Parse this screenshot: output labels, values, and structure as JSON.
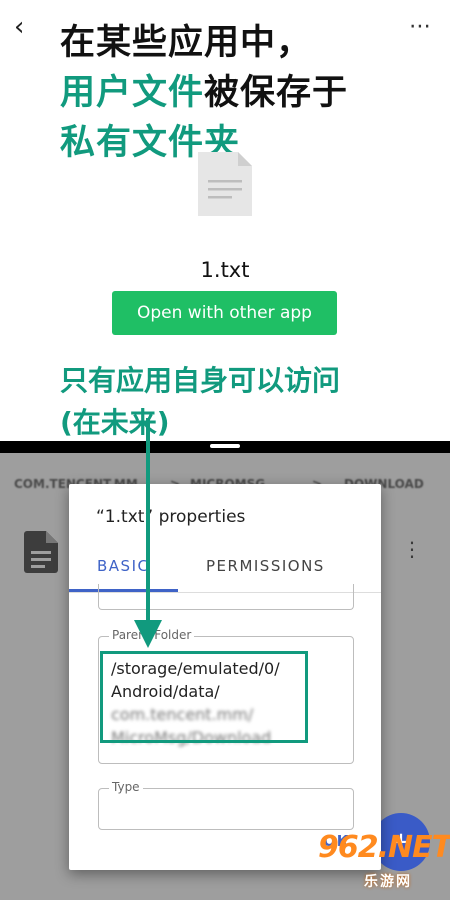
{
  "header": {
    "back_icon": "chevron-left-icon",
    "more_icon": "more-horizontal-icon",
    "headline_line1": "在某些应用中，",
    "headline_hl1": "用户文件",
    "headline_rest2": "被保存于",
    "headline_hl2": "私有文件夹"
  },
  "file": {
    "icon": "document-icon",
    "name": "1.txt",
    "open_button_label": "Open with other app"
  },
  "caption": {
    "line1": "只有应用自身可以访问",
    "line2": "(在未来)"
  },
  "background_app": {
    "breadcrumb_items": [
      "COM.TENCENT.MM",
      ">",
      "MICROMSG",
      ">",
      "DOWNLOAD"
    ],
    "file_icon": "document-icon",
    "more_icon": "more-vertical-icon",
    "fab_label": "+"
  },
  "dialog": {
    "title": "“1.txt” properties",
    "tabs": [
      {
        "label": "BASIC",
        "active": true
      },
      {
        "label": "PERMISSIONS",
        "active": false
      }
    ],
    "parent_folder_label": "Parent Folder",
    "parent_folder_lines": [
      "/storage/emulated/0/",
      "Android/data/",
      "com.tencent.mm/",
      "MicroMsg/Download"
    ],
    "type_label": "Type",
    "ok_label": "OK"
  },
  "watermark": {
    "logo": "962.NET",
    "sub": "乐游网"
  },
  "colors": {
    "accent_green": "#119a7e",
    "button_green": "#1fbf65",
    "tab_blue": "#3f63c7",
    "watermark_orange": "#ff8a1f"
  }
}
